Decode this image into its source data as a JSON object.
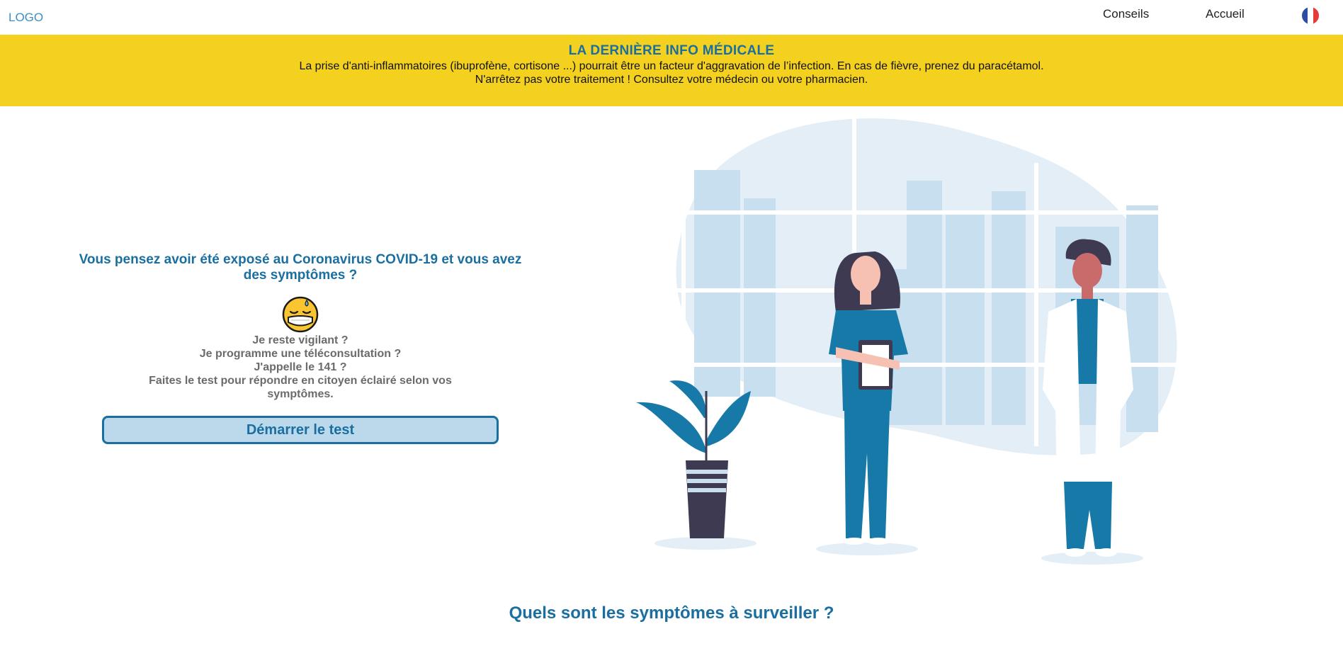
{
  "header": {
    "logo": "LOGO",
    "nav": [
      {
        "label": "Conseils"
      },
      {
        "label": "Accueil"
      }
    ],
    "language_flag_colors": [
      "#2b4ea2",
      "#ffffff",
      "#e53b3b"
    ]
  },
  "banner": {
    "title": "LA DERNIÈRE INFO MÉDICALE",
    "line1": "La prise d'anti-inflammatoires (ibuprofène, cortisone ...) pourrait être un facteur d'aggravation de l’infection. En cas de fièvre, prenez du paracétamol.",
    "line2": "N'arrêtez pas votre traitement ! Consultez votre médecin ou votre pharmacien."
  },
  "hero": {
    "title": "Vous pensez avoir été exposé au Coronavirus COVID-19 et vous avez des symptômes ?",
    "emoji_icon": "masked-face-sweat-icon",
    "lines": [
      "Je reste vigilant ?",
      "Je programme une téléconsultation ?",
      "J'appelle le 141 ?",
      "Faites le test pour répondre en citoyen éclairé selon vos symptômes."
    ],
    "start_button": "Démarrer le test"
  },
  "illustration": {
    "icon": "doctors-illustration"
  },
  "symptoms": {
    "title": "Quels sont les symptômes à surveiller ?"
  },
  "colors": {
    "accent": "#1a6fa0",
    "banner_bg": "#f4d11e",
    "button_bg": "#bcd9ec",
    "illustration_light": "#e3eef6",
    "illustration_mid": "#c7dfee",
    "scrub_blue": "#1779a8",
    "dark": "#3e3a52"
  }
}
